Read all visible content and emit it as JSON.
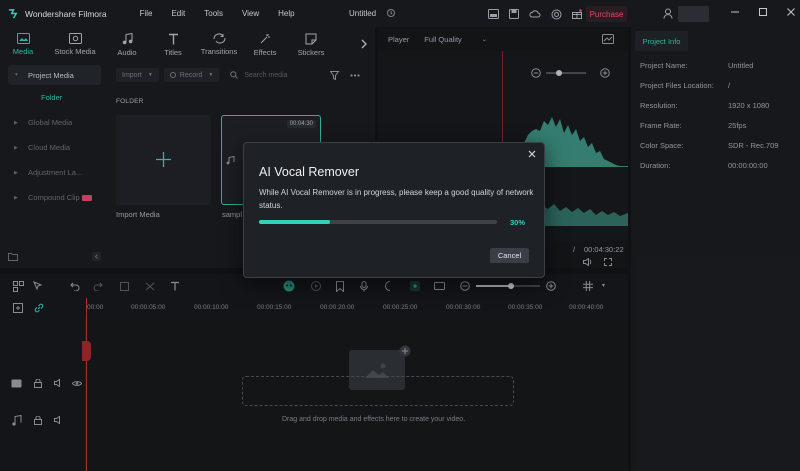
{
  "app": {
    "name": "Wondershare Filmora",
    "document_title": "Untitled",
    "purchase_label": "Purchase"
  },
  "menu": [
    "File",
    "Edit",
    "Tools",
    "View",
    "Help"
  ],
  "library": {
    "tabs": [
      {
        "label": "Media",
        "icon": "media-icon"
      },
      {
        "label": "Stock Media",
        "icon": "stock-media-icon"
      },
      {
        "label": "Audio",
        "icon": "music-note-icon"
      },
      {
        "label": "Titles",
        "icon": "text-icon"
      },
      {
        "label": "Transitions",
        "icon": "transition-icon"
      },
      {
        "label": "Effects",
        "icon": "effects-icon"
      },
      {
        "label": "Stickers",
        "icon": "sticker-icon"
      }
    ],
    "sidebar": {
      "project_media": "Project Media",
      "folder": "Folder",
      "global_media": "Global Media",
      "cloud_media": "Cloud Media",
      "adjustment_layer": "Adjustment La...",
      "compound_clip": "Compound Clip"
    },
    "toolbar": {
      "import": "Import",
      "record": "Record",
      "search_placeholder": "Search media"
    },
    "folder_heading": "FOLDER",
    "tiles": {
      "import_label": "Import Media",
      "sample_label": "sampl",
      "sample_duration": "00:04:30"
    }
  },
  "player": {
    "label": "Player",
    "quality": "Full Quality",
    "current_time": "/",
    "total_time": "00:04:30:22"
  },
  "project_info": {
    "tab": "Project Info",
    "rows": [
      {
        "key": "Project Name:",
        "value": "Untitled"
      },
      {
        "key": "Project Files Location:",
        "value": "/"
      },
      {
        "key": "Resolution:",
        "value": "1920 x 1080"
      },
      {
        "key": "Frame Rate:",
        "value": "25fps"
      },
      {
        "key": "Color Space:",
        "value": "SDR - Rec.709"
      },
      {
        "key": "Duration:",
        "value": "00:00:00:00"
      }
    ]
  },
  "timeline": {
    "ruler_labels": [
      "00:00",
      "00:00:05:00",
      "00:00:10:00",
      "00:00:15:00",
      "00:00:20:00",
      "00:00:25:00",
      "00:00:30:00",
      "00:00:35:00",
      "00:00:40:00"
    ],
    "drop_hint": "Drag and drop media and effects here to create your video."
  },
  "dialog": {
    "title": "AI Vocal Remover",
    "message": "While AI Vocal Remover is in progress, please keep a good quality of network status.",
    "progress_percent": 30,
    "progress_label": "30%",
    "cancel_label": "Cancel"
  },
  "colors": {
    "accent": "#34d0b8",
    "purchase": "#e2466f",
    "playhead": "#c23434"
  }
}
